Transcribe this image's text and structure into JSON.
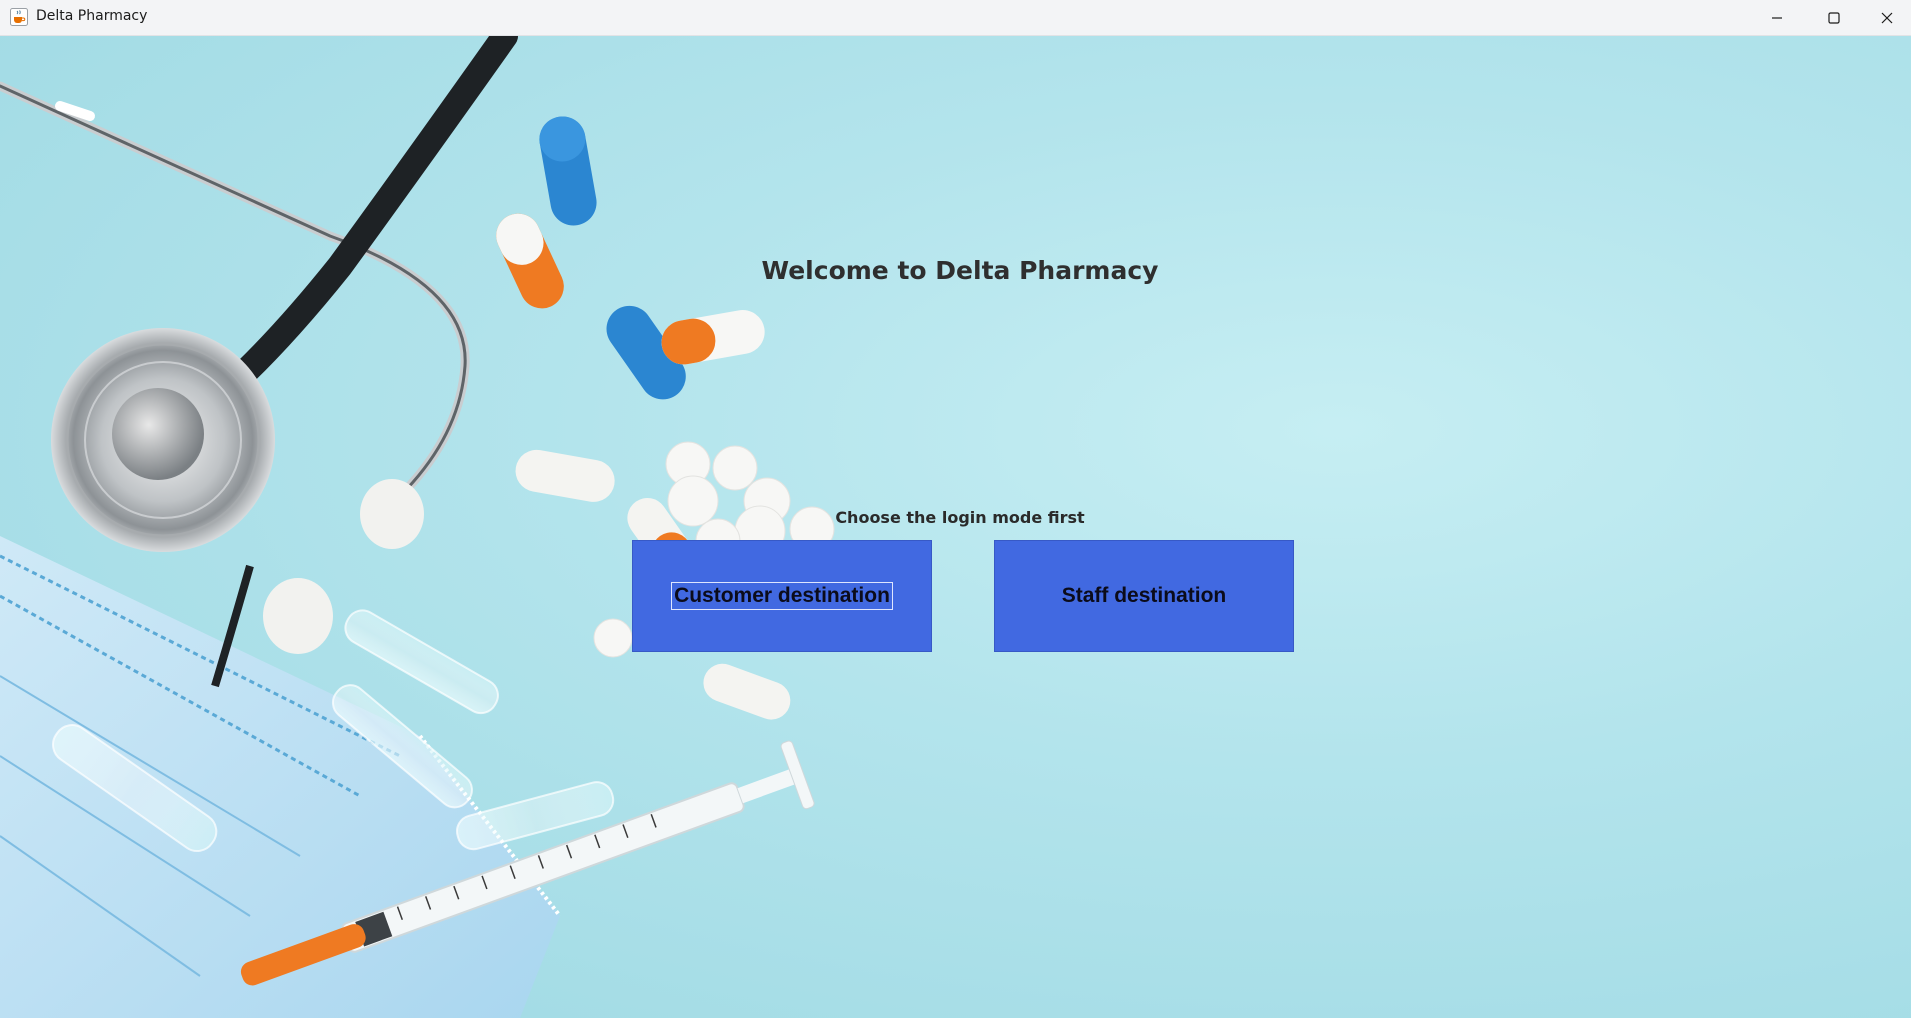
{
  "window": {
    "title": "Delta Pharmacy",
    "app_icon": "java-cup-icon",
    "controls": {
      "minimize_icon": "minimize-icon",
      "maximize_icon": "maximize-icon",
      "close_icon": "close-icon"
    }
  },
  "main": {
    "welcome_text": "Welcome to Delta Pharmacy",
    "prompt_text": "Choose the login mode first",
    "buttons": {
      "customer_label": "Customer destination",
      "staff_label": "Staff destination"
    }
  },
  "colors": {
    "button_fill": "#4169e1",
    "background": "#b3e4ec",
    "titlebar": "#f3f4f6"
  }
}
